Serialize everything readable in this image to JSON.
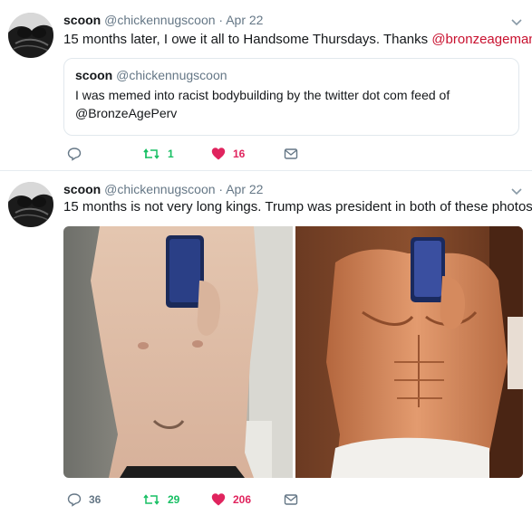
{
  "tweets": [
    {
      "name": "scoon",
      "handle": "@chickennugscoon",
      "sep": "·",
      "date": "Apr 22",
      "text": "15 months later, I owe it all to Handsome Thursdays. Thanks ",
      "mention": "@bronzeagemantis",
      "quote": {
        "name": "scoon",
        "handle": "@chickennugscoon",
        "text_line1": "I was memed into racist bodybuilding by the twitter dot com feed of",
        "text_line2": "@BronzeAgePerv"
      },
      "stats": {
        "replies": "",
        "retweets": "1",
        "likes": "16"
      }
    },
    {
      "name": "scoon",
      "handle": "@chickennugscoon",
      "sep": "·",
      "date": "Apr 22",
      "text": "15 months is not very long kings. Trump was president in both of these photos.",
      "stats": {
        "replies": "36",
        "retweets": "29",
        "likes": "206"
      }
    }
  ],
  "colors": {
    "retweet": "#17bf63",
    "like": "#e0245e",
    "icon_gray": "#657786",
    "mention": "#c8102e"
  },
  "icons": [
    "reply-icon",
    "retweet-icon",
    "heart-icon",
    "dm-envelope-icon",
    "chevron-down-icon"
  ]
}
